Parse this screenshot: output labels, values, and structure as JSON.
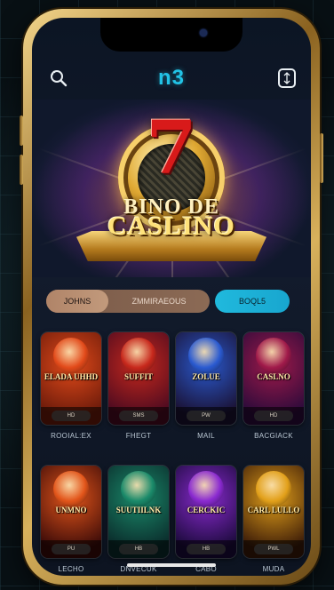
{
  "header": {
    "brand": "n3",
    "left_icon": "search-icon",
    "right_icon": "wallet-icon"
  },
  "hero": {
    "number": "7",
    "line1": "BINO DE",
    "line2": "CASLINO"
  },
  "tabs": [
    {
      "label": "JOHNS"
    },
    {
      "label": "ZMMIRAEOUS"
    },
    {
      "label": "BOQL5"
    }
  ],
  "games": [
    {
      "title": "ELADA UHHD",
      "badge": "HD",
      "label": "ROOIAL:EX",
      "bg1": "#e24a1a",
      "bg2": "#6a1a0a"
    },
    {
      "title": "SUFFIT",
      "badge": "SMS",
      "label": "FHEGT",
      "bg1": "#c7281c",
      "bg2": "#4a0a20"
    },
    {
      "title": "ZOLUE",
      "badge": "PW",
      "label": "MAIL",
      "bg1": "#2a5ad0",
      "bg2": "#1a1030"
    },
    {
      "title": "CASLNO",
      "badge": "HD",
      "label": "BACGIACK",
      "bg1": "#a01a4a",
      "bg2": "#2a0a3a"
    },
    {
      "title": "UNMNO",
      "badge": "PU",
      "label": "LECHO",
      "bg1": "#e2551a",
      "bg2": "#3a0a08"
    },
    {
      "title": "SUUTIILNK",
      "badge": "HB",
      "label": "DNVECUK",
      "bg1": "#1a8a6a",
      "bg2": "#0a2a2a"
    },
    {
      "title": "CERCKIC",
      "badge": "HB",
      "label": "CABO",
      "bg1": "#8a2ad0",
      "bg2": "#1a0a3a"
    },
    {
      "title": "CARL LULLO",
      "badge": "PWL",
      "label": "MUDA",
      "bg1": "#e2a01a",
      "bg2": "#3a1a08"
    }
  ]
}
